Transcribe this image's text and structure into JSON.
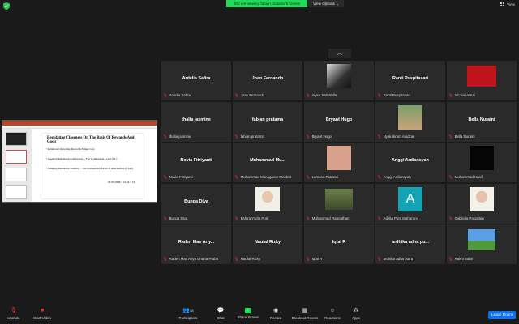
{
  "top_bar": {
    "banner": "You are viewing fabian pratama's screen",
    "view_options": "View Options ⌄",
    "view_label": "View"
  },
  "shared_slide": {
    "title": "Regulating Closeness On The Basis Of Rewards And Costs",
    "bullets": [
      "• Relational Outcome: Rewards Minus Cost",
      "• Gauging Relational Satisfaction – The Comparison Level (CL)",
      "• Gauging Relational Stability – The Comparison Level of Alternatives (CLalt)"
    ],
    "formula": "OUTCOME > CLalt > CL"
  },
  "colors": {
    "accent_green": "#23d959",
    "leave_blue": "#0e71eb",
    "mic_muted": "#e33333"
  },
  "tiles": [
    {
      "name_big": "Ardelia Safira",
      "label": "Ardelia Safira"
    },
    {
      "name_big": "Joan Fernando",
      "label": "Joan Fernando"
    },
    {
      "name_big": "",
      "label": "Alysa Salsabilla",
      "photo": "bw-portrait"
    },
    {
      "name_big": "Ranti Puspitasari",
      "label": "Ranti Puspitasari"
    },
    {
      "name_big": "",
      "label": "tuti widiastuti",
      "photo": "red-slide"
    },
    {
      "name_big": "thalia jasmine",
      "label": "thalia jasmine"
    },
    {
      "name_big": "fabian pratama",
      "label": "fabian pratama"
    },
    {
      "name_big": "Bryant Hugo",
      "label": "Bryant Hugo"
    },
    {
      "name_big": "",
      "label": "Nyak Ikram Abidzar",
      "photo": "outdoor-person"
    },
    {
      "name_big": "Bella Nuraini",
      "label": "Bella Nuraini"
    },
    {
      "name_big": "Novia Fitriyanti",
      "label": "Novia Fitriyanti"
    },
    {
      "name_big": "Muhammad Mu...",
      "label": "Muhammad Munggaran Meidrat"
    },
    {
      "name_big": "",
      "label": "Lamona Putriesli",
      "photo": "peach-square"
    },
    {
      "name_big": "Anggi Ardiansyah",
      "label": "Anggi Ardiansyah"
    },
    {
      "name_big": "",
      "label": "Muhammad Hanif",
      "photo": "black-square"
    },
    {
      "name_big": "Bunga Diva",
      "label": "Bunga Diva"
    },
    {
      "name_big": "",
      "label": "Fahira Yudia Putri",
      "photo": "girl-portrait"
    },
    {
      "name_big": "",
      "label": "Muhammad Ramadhan",
      "photo": "grid-photo"
    },
    {
      "name_big": "",
      "label": "Adelia Putri Maharani",
      "photo": "avatar-a"
    },
    {
      "name_big": "",
      "label": "Gabriela Panjaitan",
      "photo": "girl-selfie"
    },
    {
      "name_big": "Raden Mas Ariy...",
      "label": "Raden Mas Ariya Dhana Prabu"
    },
    {
      "name_big": "Naufal Rizky",
      "label": "Naufal Rizky"
    },
    {
      "name_big": "Iqfal R",
      "label": "Iqfal R"
    },
    {
      "name_big": "ardhika adha pu...",
      "label": "ardhika adha putra"
    },
    {
      "name_big": "",
      "label": "Rakhi Sabri",
      "photo": "landscape"
    }
  ],
  "avatar_letter": "A",
  "toolbar": {
    "unmute": "Unmute",
    "start_video": "Start Video",
    "participants": "Participants",
    "participants_count": "38",
    "chat": "Chat",
    "share_screen": "Share Screen",
    "record": "Record",
    "breakout": "Breakout Rooms",
    "reactions": "Reactions",
    "apps": "Apps",
    "leave": "Leave Room"
  }
}
